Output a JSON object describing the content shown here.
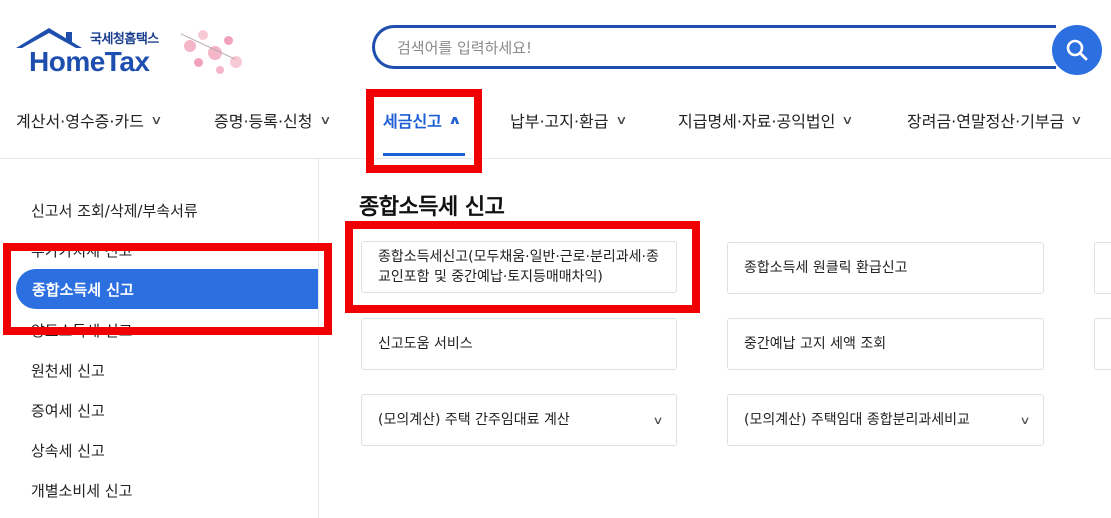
{
  "logo": {
    "subtitle": "국세청홈택스",
    "brand": "HomeTax"
  },
  "search": {
    "placeholder": "검색어를 입력하세요!",
    "value": "",
    "icon": "search-icon"
  },
  "nav": {
    "items": [
      {
        "label": "계산서·영수증·카드",
        "active": false
      },
      {
        "label": "증명·등록·신청",
        "active": false
      },
      {
        "label": "세금신고",
        "active": true
      },
      {
        "label": "납부·고지·환급",
        "active": false
      },
      {
        "label": "지급명세·자료·공익법인",
        "active": false
      },
      {
        "label": "장려금·연말정산·기부금",
        "active": false
      }
    ]
  },
  "sidebar": {
    "items": [
      {
        "label": "신고서 조회/삭제/부속서류"
      },
      {
        "label": "부가가치세 신고"
      },
      {
        "label": "종합소득세 신고",
        "active": true
      },
      {
        "label": "양도소득세 신고"
      },
      {
        "label": "원천세 신고"
      },
      {
        "label": "증여세 신고"
      },
      {
        "label": "상속세 신고"
      },
      {
        "label": "개별소비세 신고"
      }
    ]
  },
  "main": {
    "title": "종합소득세 신고",
    "cards": [
      {
        "label": "종합소득세신고(모두채움·일반·근로·분리과세·종교인포함 및 중간예납·토지등매매차익)"
      },
      {
        "label": "종합소득세 원클릭 환급신고"
      },
      {
        "label": "신고도움 서비스"
      },
      {
        "label": "중간예납 고지 세액 조회"
      },
      {
        "label": "(모의계산) 주택 간주임대료 계산"
      },
      {
        "label": "(모의계산) 주택임대 종합분리과세비교"
      }
    ]
  },
  "colors": {
    "accent": "#2b6fe0",
    "brand": "#1e4fae",
    "annotation": "#f00000"
  }
}
